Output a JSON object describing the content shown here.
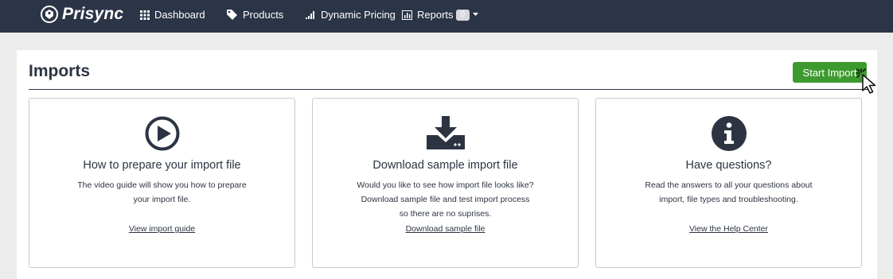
{
  "navbar": {
    "brand": "Prisync",
    "items": [
      {
        "label": "Dashboard",
        "icon": "grid-icon"
      },
      {
        "label": "Products",
        "icon": "tag-icon"
      },
      {
        "label": "Dynamic Pricing",
        "icon": "signal-bars-icon"
      },
      {
        "label": "Reports",
        "icon": "bar-chart-icon",
        "badge": "0"
      }
    ]
  },
  "page": {
    "title": "Imports",
    "start_button": "Start Import"
  },
  "cards": [
    {
      "icon": "play-circle-icon",
      "title": "How to prepare your import file",
      "desc_lines": [
        "The video guide will show you how to prepare",
        "your import file."
      ],
      "link": "View import guide"
    },
    {
      "icon": "download-icon",
      "title": "Download sample import file",
      "desc_lines": [
        "Would you like to see how import file looks like?",
        "Download sample file and test import process",
        "so there are no suprises."
      ],
      "link": "Download sample file"
    },
    {
      "icon": "info-circle-icon",
      "title": "Have questions?",
      "desc_lines": [
        "Read the answers to all your questions about",
        "import, file types and troubleshooting."
      ],
      "link": "View the Help Center"
    }
  ],
  "colors": {
    "navbar": "#2c3447",
    "accent_green": "#3d9a2e",
    "text": "#2c3442"
  }
}
